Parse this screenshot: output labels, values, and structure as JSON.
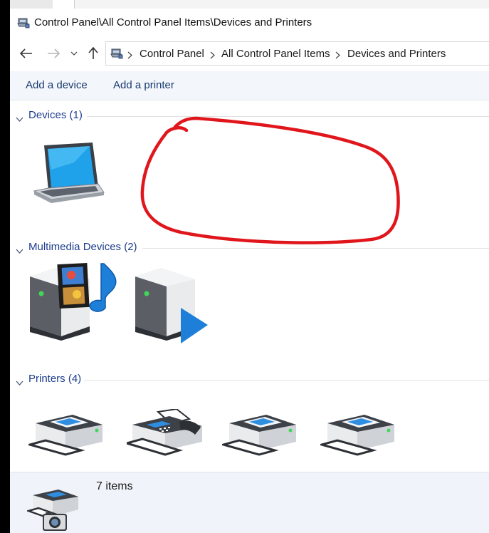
{
  "title": "Control Panel\\All Control Panel Items\\Devices and Printers",
  "breadcrumbs": [
    "Control Panel",
    "All Control Panel Items",
    "Devices and Printers"
  ],
  "toolbar": {
    "add_device": "Add a device",
    "add_printer": "Add a printer"
  },
  "groups": {
    "devices": "Devices (1)",
    "multimedia": "Multimedia Devices (2)",
    "printers": "Printers (4)"
  },
  "status": {
    "count": "7 items"
  },
  "colors": {
    "group_title": "#1e3d8f",
    "toolbar_bg": "#f3f6fb",
    "annotation": "#e0161c"
  }
}
